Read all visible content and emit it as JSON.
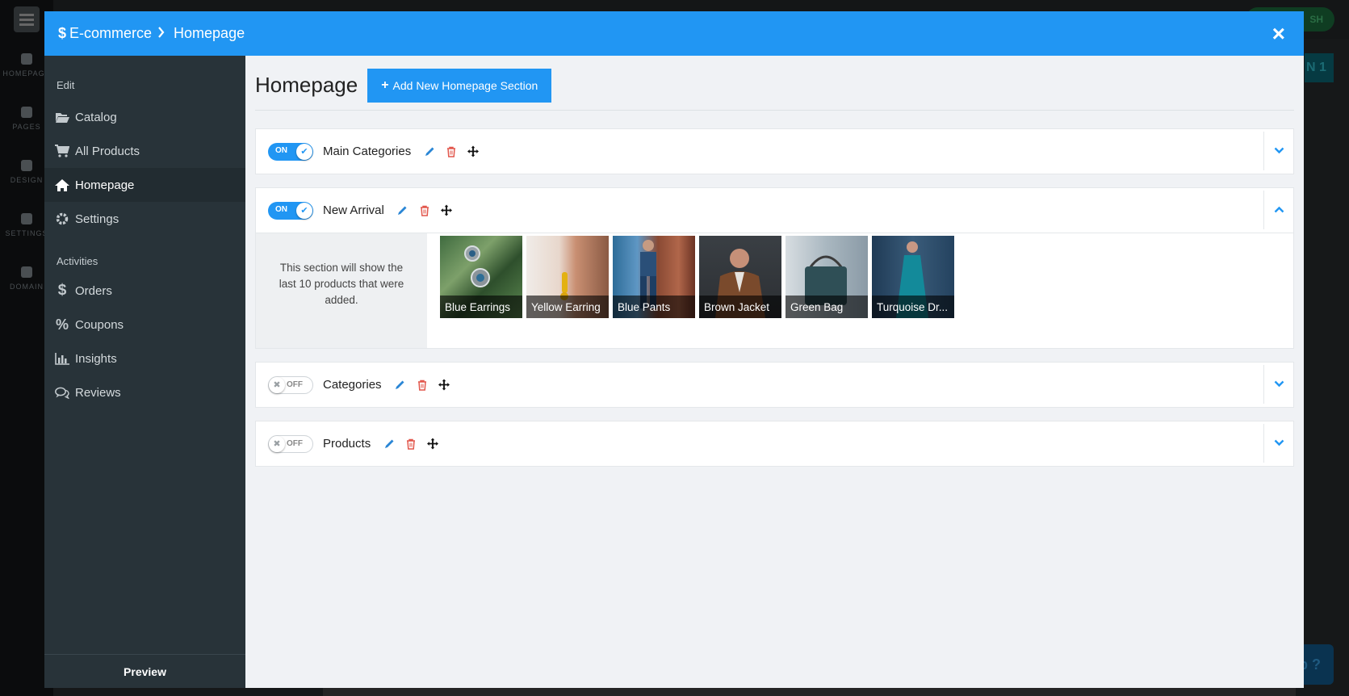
{
  "background": {
    "nav": [
      {
        "label": "HOMEPAGE"
      },
      {
        "label": "PAGES"
      },
      {
        "label": "DESIGN"
      },
      {
        "label": "SETTINGS"
      },
      {
        "label": "DOMAIN"
      }
    ],
    "publish_label": "SH",
    "strip_label": "N 1",
    "help_label": "lp ?"
  },
  "modal": {
    "breadcrumb": {
      "root": "E-commerce",
      "current": "Homepage"
    },
    "close_label": "×"
  },
  "sidebar": {
    "edit_heading": "Edit",
    "edit_items": [
      {
        "label": "Catalog",
        "icon": "folder-open-icon"
      },
      {
        "label": "All Products",
        "icon": "cart-icon"
      },
      {
        "label": "Homepage",
        "icon": "home-icon",
        "active": true
      },
      {
        "label": "Settings",
        "icon": "gear-icon"
      }
    ],
    "activities_heading": "Activities",
    "activity_items": [
      {
        "label": "Orders",
        "icon": "dollar-icon"
      },
      {
        "label": "Coupons",
        "icon": "percent-icon"
      },
      {
        "label": "Insights",
        "icon": "bar-chart-icon"
      },
      {
        "label": "Reviews",
        "icon": "comments-icon"
      }
    ],
    "preview_label": "Preview"
  },
  "main": {
    "title": "Homepage",
    "add_button_label": "Add New Homepage Section",
    "sections": [
      {
        "name": "Main Categories",
        "toggle": "ON",
        "expanded": false
      },
      {
        "name": "New Arrival",
        "toggle": "ON",
        "expanded": true,
        "info": "This section will show the last 10 products that were added.",
        "products": [
          {
            "name": "Blue Earrings"
          },
          {
            "name": "Yellow Earring"
          },
          {
            "name": "Blue Pants"
          },
          {
            "name": "Brown Jacket"
          },
          {
            "name": "Green Bag"
          },
          {
            "name": "Turquoise Dr..."
          }
        ]
      },
      {
        "name": "Categories",
        "toggle": "OFF",
        "expanded": false
      },
      {
        "name": "Products",
        "toggle": "OFF",
        "expanded": false
      }
    ]
  },
  "colors": {
    "header_blue": "#2196f3",
    "sidebar_dark": "#283339",
    "delete_red": "#e2574c",
    "edit_blue": "#2a86d5"
  }
}
